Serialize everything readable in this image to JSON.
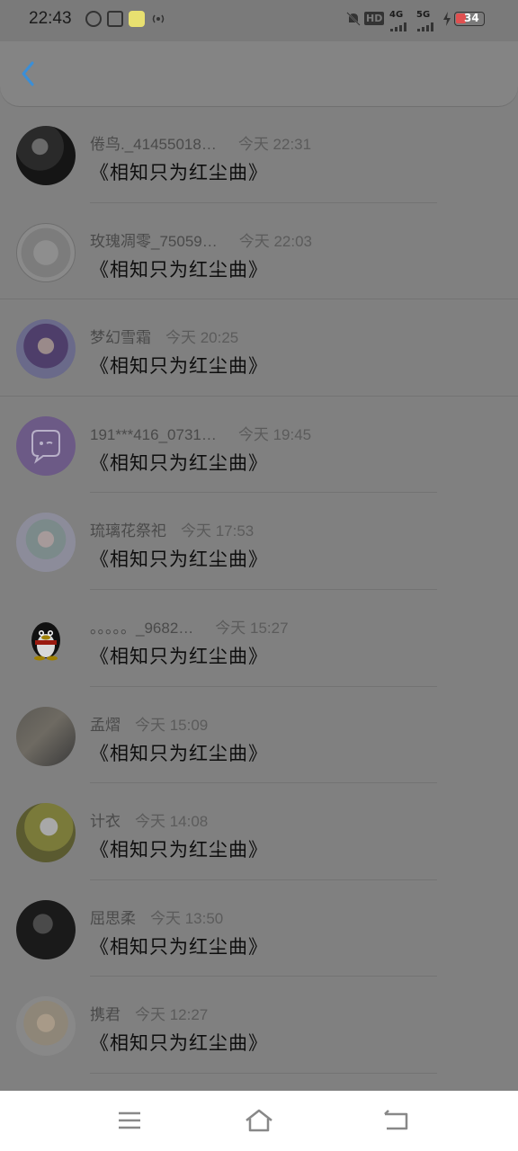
{
  "status": {
    "time": "22:43",
    "hd": "HD",
    "network1": "4G",
    "network2": "5G",
    "battery": "34"
  },
  "colors": {
    "accent": "#3a8fd8",
    "battery_red": "#e05050"
  },
  "messages": [
    {
      "name": "倦鸟._41455018…",
      "time": "今天 22:31",
      "text": "《相知只为红尘曲》",
      "avatar": "dark-user-avatar"
    },
    {
      "name": "玫瑰凋零_75059…",
      "time": "今天 22:03",
      "text": "《相知只为红尘曲》",
      "avatar": "sketch-anime-avatar"
    },
    {
      "name": "梦幻雪霜",
      "time": "今天 20:25",
      "text": "《相知只为红尘曲》",
      "avatar": "anime-girl-avatar"
    },
    {
      "name": "191***416_0731…",
      "time": "今天 19:45",
      "text": "《相知只为红尘曲》",
      "avatar": "chat-bubble-avatar"
    },
    {
      "name": "琉璃花祭祀",
      "time": "今天 17:53",
      "text": "《相知只为红尘曲》",
      "avatar": "anime-character-avatar"
    },
    {
      "name": "。。。。。_9682…",
      "time": "今天 15:27",
      "text": "《相知只为红尘曲》",
      "avatar": "qq-penguin-avatar"
    },
    {
      "name": "孟熠",
      "time": "今天 15:09",
      "text": "《相知只为红尘曲》",
      "avatar": "cat-photo-avatar"
    },
    {
      "name": "计衣",
      "time": "今天 14:08",
      "text": "《相知只为红尘曲》",
      "avatar": "bunny-avatar"
    },
    {
      "name": "屈思柔",
      "time": "今天 13:50",
      "text": "《相知只为红尘曲》",
      "avatar": "dark-portrait-avatar"
    },
    {
      "name": "携君",
      "time": "今天 12:27",
      "text": "《相知只为红尘曲》",
      "avatar": "anime-blonde-avatar"
    }
  ]
}
